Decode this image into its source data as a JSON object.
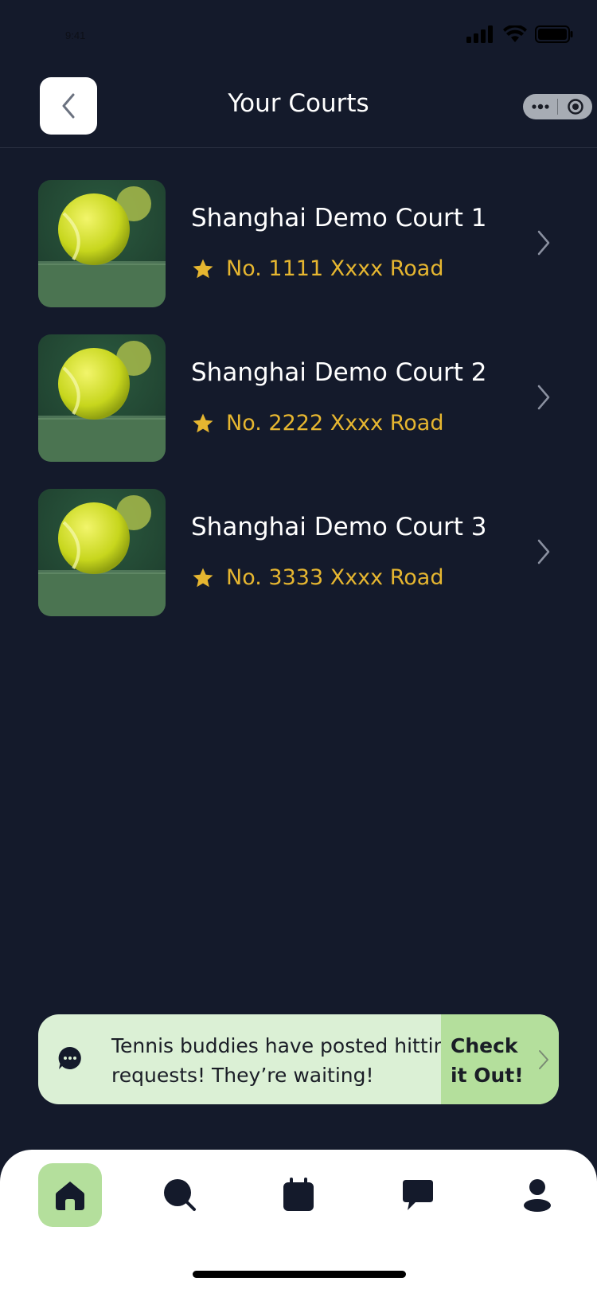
{
  "status_bar": {
    "time": "9:41"
  },
  "header": {
    "title": "Your Courts"
  },
  "courts": [
    {
      "name": "Shanghai Demo Court 1",
      "address": "No. 1111 Xxxx Road"
    },
    {
      "name": "Shanghai Demo Court 2",
      "address": "No. 2222 Xxxx Road"
    },
    {
      "name": "Shanghai Demo Court 3",
      "address": "No. 3333 Xxxx Road"
    }
  ],
  "banner": {
    "message": "Tennis buddies have posted hitting requests! They’re waiting!",
    "cta": "Check it Out!"
  },
  "tab_bar": {
    "tabs": [
      {
        "icon": "home-icon",
        "active": true
      },
      {
        "icon": "search-icon",
        "active": false
      },
      {
        "icon": "calendar-icon",
        "active": false
      },
      {
        "icon": "message-icon",
        "active": false
      },
      {
        "icon": "profile-icon",
        "active": false
      }
    ]
  },
  "colors": {
    "background": "#141a2b",
    "accent_green": "#b4df9c",
    "banner_bg": "#dbf0d5",
    "address_gold": "#e6b630"
  }
}
